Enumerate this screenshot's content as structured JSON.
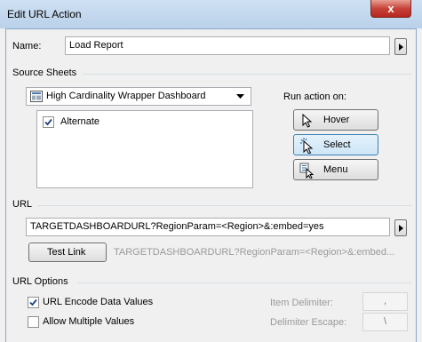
{
  "window": {
    "title": "Edit URL Action",
    "close_glyph": "x"
  },
  "name_field": {
    "label": "Name:",
    "value": "Load Report"
  },
  "source_sheets": {
    "section_label": "Source Sheets",
    "dashboard": "High Cardinality Wrapper Dashboard",
    "sheets": [
      {
        "label": "Alternate",
        "checked": true
      }
    ]
  },
  "run_action": {
    "label": "Run action on:",
    "options": [
      {
        "label": "Hover",
        "icon": "cursor-arrow-icon",
        "selected": false
      },
      {
        "label": "Select",
        "icon": "cursor-click-icon",
        "selected": true
      },
      {
        "label": "Menu",
        "icon": "menu-cursor-icon",
        "selected": false
      }
    ]
  },
  "url": {
    "section_label": "URL",
    "value": "TARGETDASHBOARDURL?RegionParam=<Region>&:embed=yes",
    "test_link_label": "Test Link",
    "preview": "TARGETDASHBOARDURL?RegionParam=<Region>&:embed..."
  },
  "url_options": {
    "section_label": "URL Options",
    "encode_label": "URL Encode Data Values",
    "encode_checked": true,
    "multiple_label": "Allow Multiple Values",
    "multiple_checked": false,
    "item_delimiter_label": "Item Delimiter:",
    "item_delimiter_value": ",",
    "delimiter_escape_label": "Delimiter Escape:",
    "delimiter_escape_value": "\\"
  }
}
